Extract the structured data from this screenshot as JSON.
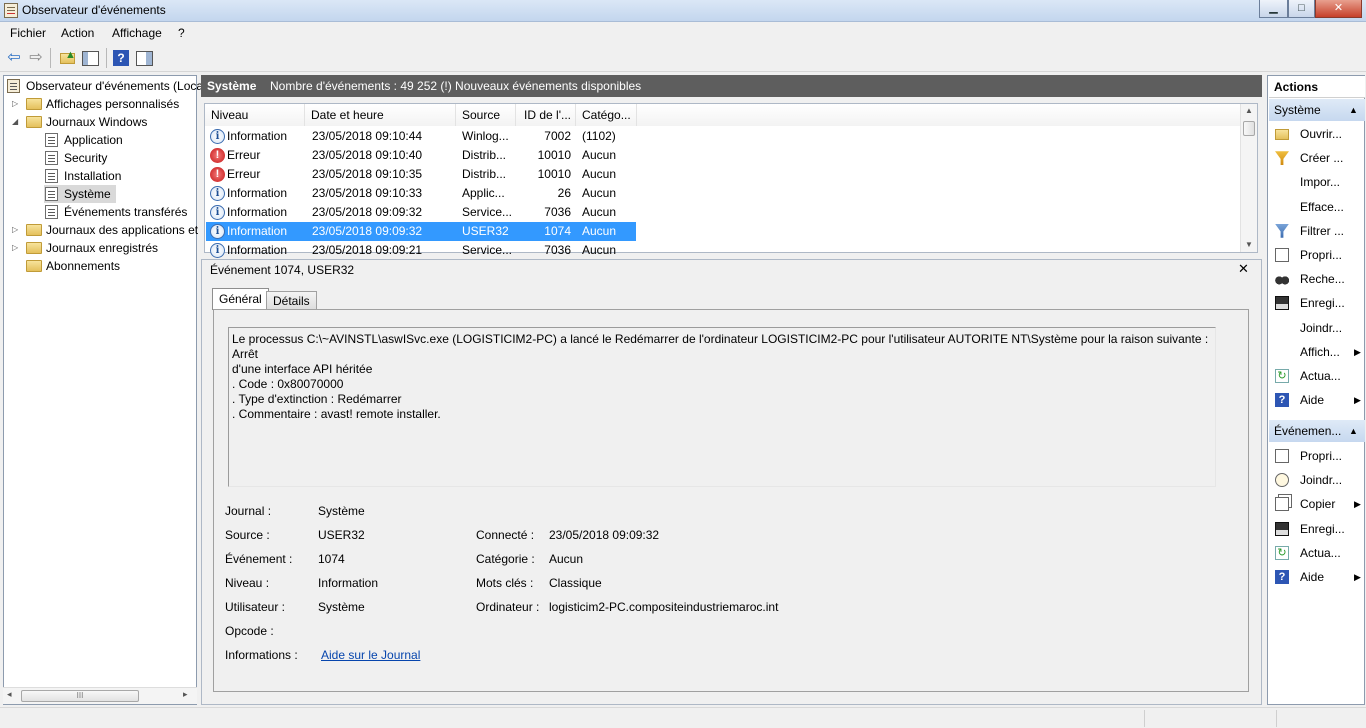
{
  "window": {
    "title": "Observateur d'événements",
    "controls": {
      "minimize": "▁",
      "maximize": "□",
      "close": "✕"
    }
  },
  "menu": {
    "fichier": "Fichier",
    "action": "Action",
    "affichage": "Affichage",
    "help": "?"
  },
  "tree": {
    "root": "Observateur d'événements (Loca",
    "custom_views": "Affichages personnalisés",
    "windows_logs": "Journaux Windows",
    "application": "Application",
    "security": "Security",
    "installation": "Installation",
    "systeme": "Système",
    "forwarded": "Événements transférés",
    "app_service_logs": "Journaux des applications et",
    "saved_logs": "Journaux enregistrés",
    "subscriptions": "Abonnements",
    "hscroll_thumb": "III"
  },
  "center": {
    "log_name": "Système",
    "summary": "Nombre d'événements : 49 252 (!) Nouveaux événements disponibles"
  },
  "events_table": {
    "columns": [
      "Niveau",
      "Date et heure",
      "Source",
      "ID de l'...",
      "Catégo..."
    ],
    "rows": [
      {
        "level": "Information",
        "type": "info",
        "date": "23/05/2018 09:10:44",
        "source": "Winlog...",
        "id": "7002",
        "category": "(1102)"
      },
      {
        "level": "Erreur",
        "type": "error",
        "date": "23/05/2018 09:10:40",
        "source": "Distrib...",
        "id": "10010",
        "category": "Aucun"
      },
      {
        "level": "Erreur",
        "type": "error",
        "date": "23/05/2018 09:10:35",
        "source": "Distrib...",
        "id": "10010",
        "category": "Aucun"
      },
      {
        "level": "Information",
        "type": "info",
        "date": "23/05/2018 09:10:33",
        "source": "Applic...",
        "id": "26",
        "category": "Aucun"
      },
      {
        "level": "Information",
        "type": "info",
        "date": "23/05/2018 09:09:32",
        "source": "Service...",
        "id": "7036",
        "category": "Aucun"
      },
      {
        "level": "Information",
        "type": "info",
        "date": "23/05/2018 09:09:32",
        "source": "USER32",
        "id": "1074",
        "category": "Aucun",
        "selected": true
      },
      {
        "level": "Information",
        "type": "info",
        "date": "23/05/2018 09:09:21",
        "source": "Service...",
        "id": "7036",
        "category": "Aucun"
      }
    ]
  },
  "detail": {
    "title": "Événement 1074, USER32",
    "tabs": [
      "Général",
      "Détails"
    ],
    "message": {
      "line1": "Le processus C:\\~AVINSTL\\aswISvc.exe (LOGISTICIM2-PC) a lancé le Redémarrer de l'ordinateur LOGISTICIM2-PC pour l'utilisateur AUTORITE NT\\Système pour la raison suivante : Arrêt",
      "line2": "d'une interface API héritée",
      "line3": " .  Code : 0x80070000",
      "line4": " .  Type d'extinction : Redémarrer",
      "line5": " .  Commentaire : avast! remote installer."
    },
    "fields": {
      "journal_label": "Journal :",
      "journal": "Système",
      "source_label": "Source :",
      "source": "USER32",
      "connecte_label": "Connecté :",
      "connecte": "23/05/2018 09:09:32",
      "evenement_label": "Événement :",
      "evenement": "1074",
      "categorie_label": "Catégorie :",
      "categorie": "Aucun",
      "niveau_label": "Niveau :",
      "niveau": "Information",
      "motscles_label": "Mots clés :",
      "motscles": "Classique",
      "utilisateur_label": "Utilisateur :",
      "utilisateur": "Système",
      "ordinateur_label": "Ordinateur :",
      "ordinateur": "logisticim2-PC.compositeindustriemaroc.int",
      "opcode_label": "Opcode :",
      "informations_label": "Informations :",
      "informations_link": "Aide sur le Journal"
    }
  },
  "actions": {
    "header": "Actions",
    "section1": "Système",
    "section1_items": [
      "Ouvrir...",
      "Créer ...",
      "Impor...",
      "Efface...",
      "Filtrer ...",
      "Propri...",
      "Reche...",
      "Enregi...",
      "Joindr...",
      "Affich...",
      "Actua...",
      "Aide"
    ],
    "section2": "Événemen...",
    "section2_items": [
      "Propri...",
      "Joindr...",
      "Copier",
      "Enregi...",
      "Actua...",
      "Aide"
    ]
  },
  "colors": {
    "selection": "#3399ff",
    "header_dark": "#5e5e5e",
    "link": "#0645ad",
    "error": "#c61616"
  }
}
